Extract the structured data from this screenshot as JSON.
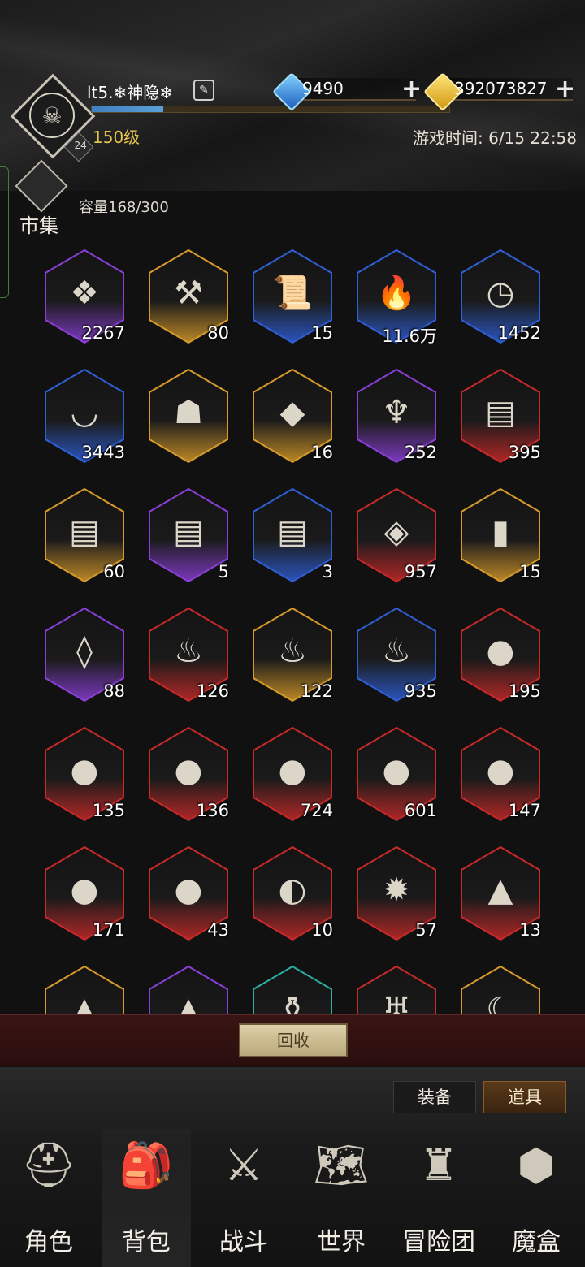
{
  "header": {
    "player_name": "lt5.❄神隐❄",
    "level_label": "150级",
    "avatar_level": "24",
    "xp_progress": 0.2,
    "game_time": "游戏时间: 6/15 22:58",
    "gems": "9490",
    "gold": "392073827"
  },
  "market": {
    "label": "市集"
  },
  "inventory": {
    "capacity": "容量168/300",
    "items": [
      {
        "count": "2267",
        "rarity": "purple",
        "icon": "crystal"
      },
      {
        "count": "80",
        "rarity": "orange",
        "icon": "hammer"
      },
      {
        "count": "15",
        "rarity": "blue",
        "icon": "scroll"
      },
      {
        "count": "11.6万",
        "rarity": "blue",
        "icon": "torch"
      },
      {
        "count": "1452",
        "rarity": "blue",
        "icon": "pocket-watch"
      },
      {
        "count": "3443",
        "rarity": "blue",
        "icon": "bowl"
      },
      {
        "count": "",
        "rarity": "orange",
        "icon": "mask"
      },
      {
        "count": "16",
        "rarity": "orange",
        "icon": "gold-gem"
      },
      {
        "count": "252",
        "rarity": "purple",
        "icon": "chalice"
      },
      {
        "count": "395",
        "rarity": "red",
        "icon": "rune-tablet"
      },
      {
        "count": "60",
        "rarity": "orange",
        "icon": "rune-tablet"
      },
      {
        "count": "5",
        "rarity": "purple",
        "icon": "rune-tablet"
      },
      {
        "count": "3",
        "rarity": "blue",
        "icon": "rune-tablet"
      },
      {
        "count": "957",
        "rarity": "red",
        "icon": "rune-stone"
      },
      {
        "count": "15",
        "rarity": "orange",
        "icon": "banner"
      },
      {
        "count": "88",
        "rarity": "purple",
        "icon": "teardrop-gem"
      },
      {
        "count": "126",
        "rarity": "red",
        "icon": "spirit-flame"
      },
      {
        "count": "122",
        "rarity": "orange",
        "icon": "spirit-flame"
      },
      {
        "count": "935",
        "rarity": "blue",
        "icon": "spirit-flame"
      },
      {
        "count": "195",
        "rarity": "red",
        "icon": "moon-orb"
      },
      {
        "count": "135",
        "rarity": "red",
        "icon": "moon-orb"
      },
      {
        "count": "136",
        "rarity": "red",
        "icon": "moon-orb"
      },
      {
        "count": "724",
        "rarity": "red",
        "icon": "moon-orb"
      },
      {
        "count": "601",
        "rarity": "red",
        "icon": "moon-orb"
      },
      {
        "count": "147",
        "rarity": "red",
        "icon": "moon-orb"
      },
      {
        "count": "171",
        "rarity": "red",
        "icon": "moon-orb"
      },
      {
        "count": "43",
        "rarity": "red",
        "icon": "moon-orb"
      },
      {
        "count": "10",
        "rarity": "red",
        "icon": "broken-moon"
      },
      {
        "count": "57",
        "rarity": "red",
        "icon": "spiked-orb"
      },
      {
        "count": "13",
        "rarity": "red",
        "icon": "sand-pile"
      },
      {
        "count": "",
        "rarity": "orange",
        "icon": "sand-pile"
      },
      {
        "count": "",
        "rarity": "purple",
        "icon": "sand-pile"
      },
      {
        "count": "",
        "rarity": "teal",
        "icon": "vase"
      },
      {
        "count": "",
        "rarity": "red",
        "icon": "fangs"
      },
      {
        "count": "",
        "rarity": "orange",
        "icon": "horn"
      }
    ]
  },
  "actions": {
    "recycle": "回收"
  },
  "tabs": {
    "equip": "装备",
    "items": "道具"
  },
  "nav": [
    {
      "label": "角色",
      "icon": "helmet"
    },
    {
      "label": "背包",
      "icon": "backpack"
    },
    {
      "label": "战斗",
      "icon": "sword-shield"
    },
    {
      "label": "世界",
      "icon": "map-scroll"
    },
    {
      "label": "冒险团",
      "icon": "castle"
    },
    {
      "label": "魔盒",
      "icon": "magic-cube"
    }
  ],
  "colors": {
    "purple": "#8a3fd6",
    "orange": "#d69a2a",
    "blue": "#2f5fd6",
    "red": "#c82a2a",
    "teal": "#2ab0a0",
    "level_gold": "#e6c34c"
  }
}
